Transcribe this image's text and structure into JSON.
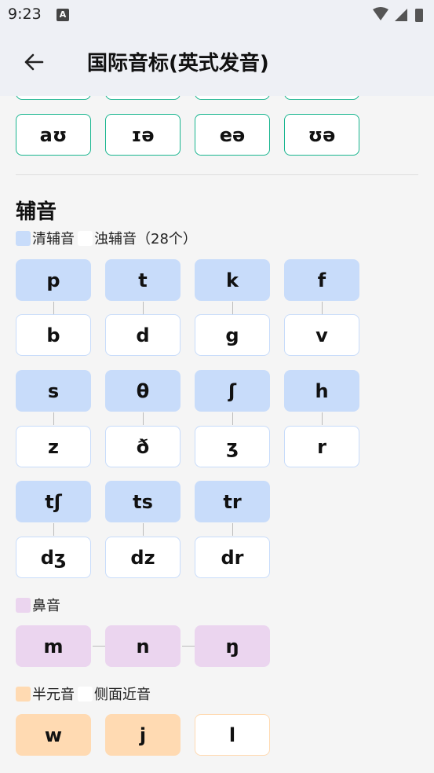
{
  "status": {
    "time": "9:23",
    "badge": "A"
  },
  "appbar": {
    "title": "国际音标(英式发音)"
  },
  "vowels": [
    "aʊ",
    "ɪə",
    "eə",
    "ʊə"
  ],
  "consonants": {
    "heading": "辅音",
    "legend_voiceless": "清辅音",
    "legend_voiced": "浊辅音（28个）",
    "voiceless_rows": [
      [
        "p",
        "t",
        "k",
        "f"
      ],
      [
        "s",
        "θ",
        "ʃ",
        "h"
      ],
      [
        "tʃ",
        "ts",
        "tr"
      ]
    ],
    "voiced_rows": [
      [
        "b",
        "d",
        "g",
        "v"
      ],
      [
        "z",
        "ð",
        "ʒ",
        "r"
      ],
      [
        "dʒ",
        "dz",
        "dr"
      ]
    ]
  },
  "nasal": {
    "legend": "鼻音",
    "items": [
      "m",
      "n",
      "ŋ"
    ]
  },
  "approximant": {
    "legend_semi": "半元音",
    "legend_lateral": "侧面近音",
    "items": [
      "w",
      "j",
      "l"
    ]
  },
  "colors": {
    "vowel_border": "#19b58f",
    "voiceless": "#c8dcfa",
    "nasal": "#ebd5ef",
    "semi": "#ffdab2"
  }
}
